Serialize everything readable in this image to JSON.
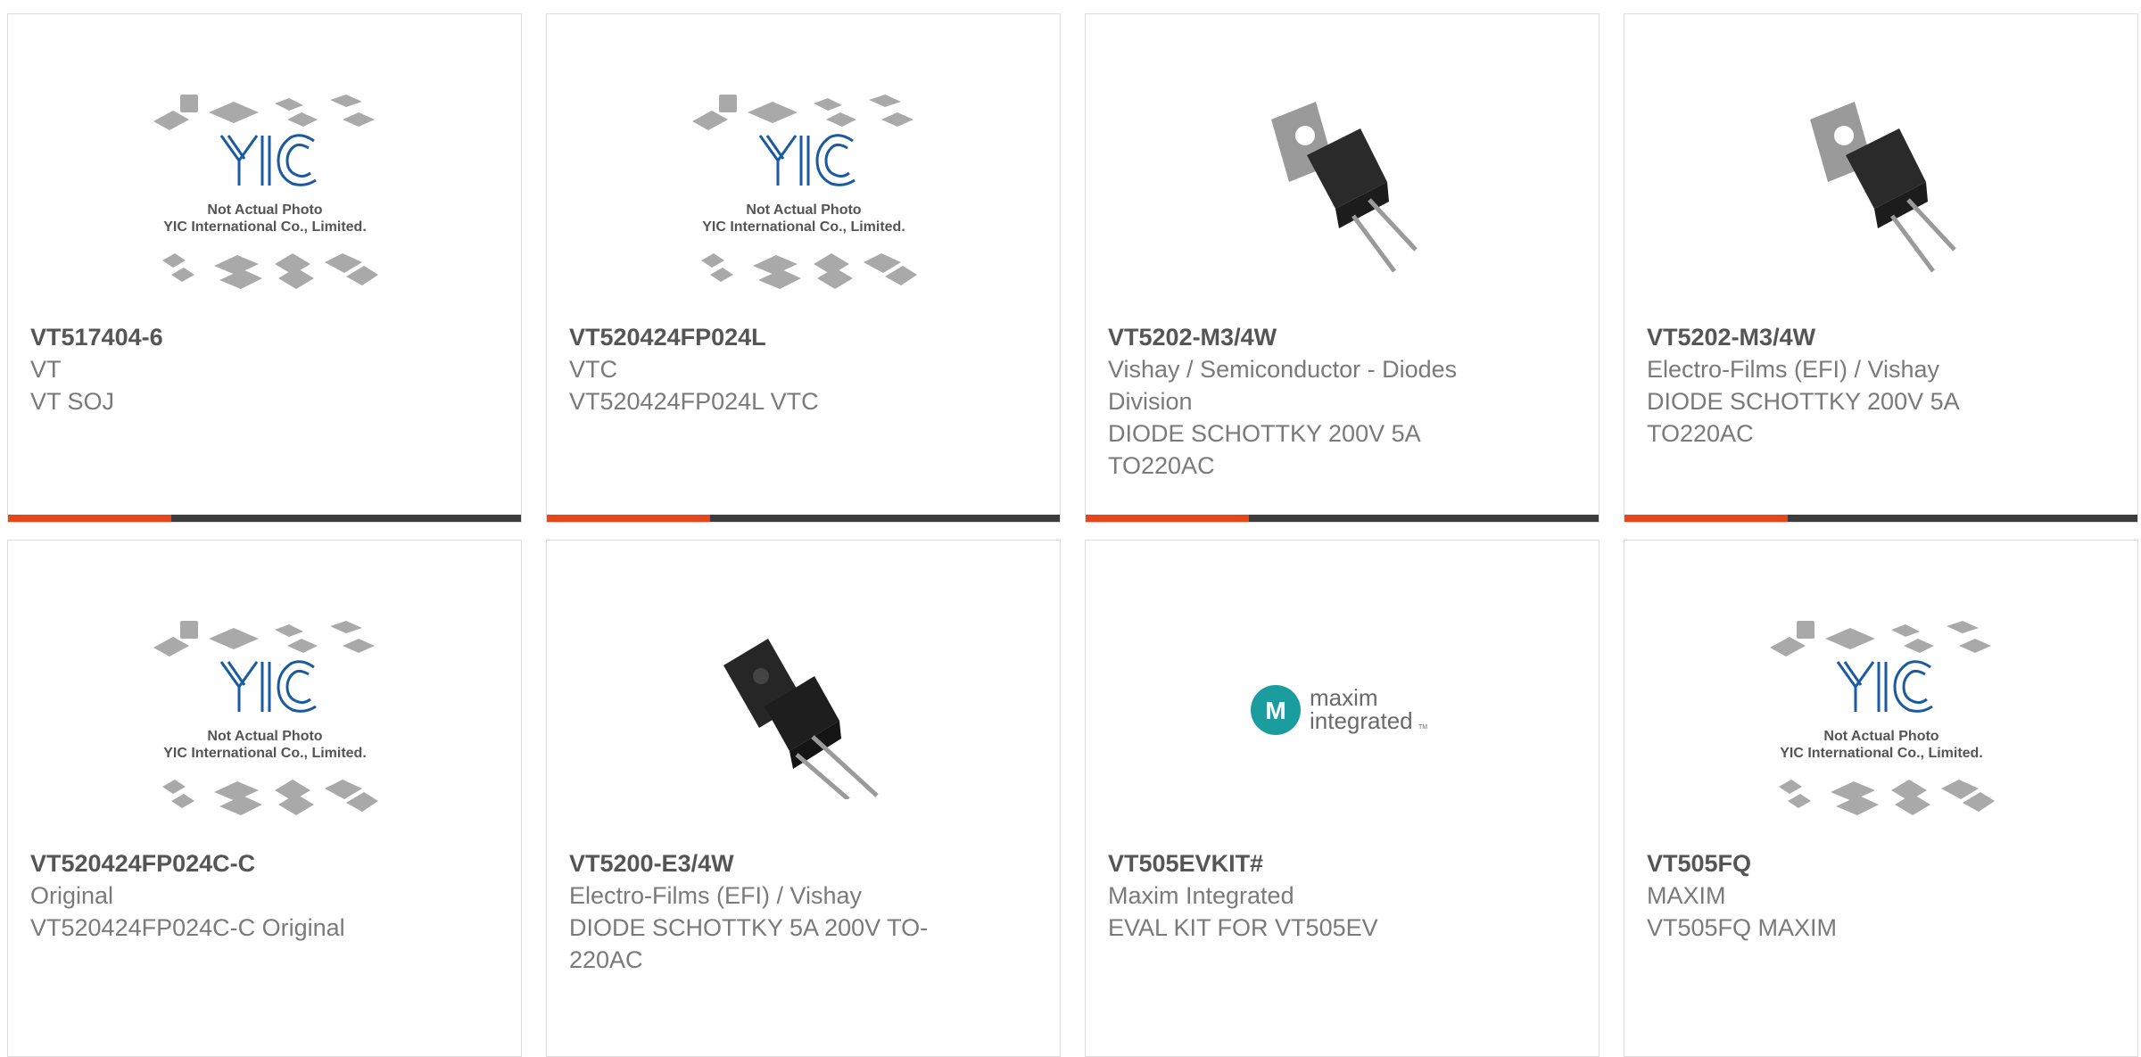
{
  "accent_color": "#e64619",
  "bar_color": "#3c3c3c",
  "placeholder": {
    "line1": "Not Actual Photo",
    "line2": "YIC International Co., Limited.",
    "brand": "YIC"
  },
  "maxim_logo": {
    "line1": "maxim",
    "line2": "integrated",
    "tm": "TM"
  },
  "products": [
    {
      "part": "VT517404-6",
      "lines": [
        "VT",
        "VT SOJ"
      ],
      "image": "yic-placeholder-photo"
    },
    {
      "part": "VT520424FP024L",
      "lines": [
        "VTC",
        "VT520424FP024L VTC"
      ],
      "image": "yic-placeholder-photo"
    },
    {
      "part": "VT5202-M3/4W",
      "lines": [
        "Vishay / Semiconductor - Diodes",
        "Division",
        "DIODE SCHOTTKY 200V 5A",
        "TO220AC"
      ],
      "image": "to220-diode-photo"
    },
    {
      "part": "VT5202-M3/4W",
      "lines": [
        "Electro-Films (EFI) / Vishay",
        "DIODE SCHOTTKY 200V 5A",
        "TO220AC"
      ],
      "image": "to220-diode-photo"
    },
    {
      "part": "VT520424FP024C-C",
      "lines": [
        "Original",
        "VT520424FP024C-C Original"
      ],
      "image": "yic-placeholder-photo"
    },
    {
      "part": "VT5200-E3/4W",
      "lines": [
        "Electro-Films (EFI) / Vishay",
        "DIODE SCHOTTKY 5A 200V TO-",
        "220AC"
      ],
      "image": "to220-fullpak-diode-photo"
    },
    {
      "part": "VT505EVKIT#",
      "lines": [
        "Maxim Integrated",
        "EVAL KIT FOR VT505EV"
      ],
      "image": "maxim-integrated-logo"
    },
    {
      "part": "VT505FQ",
      "lines": [
        "MAXIM",
        "VT505FQ MAXIM"
      ],
      "image": "yic-placeholder-photo"
    }
  ]
}
